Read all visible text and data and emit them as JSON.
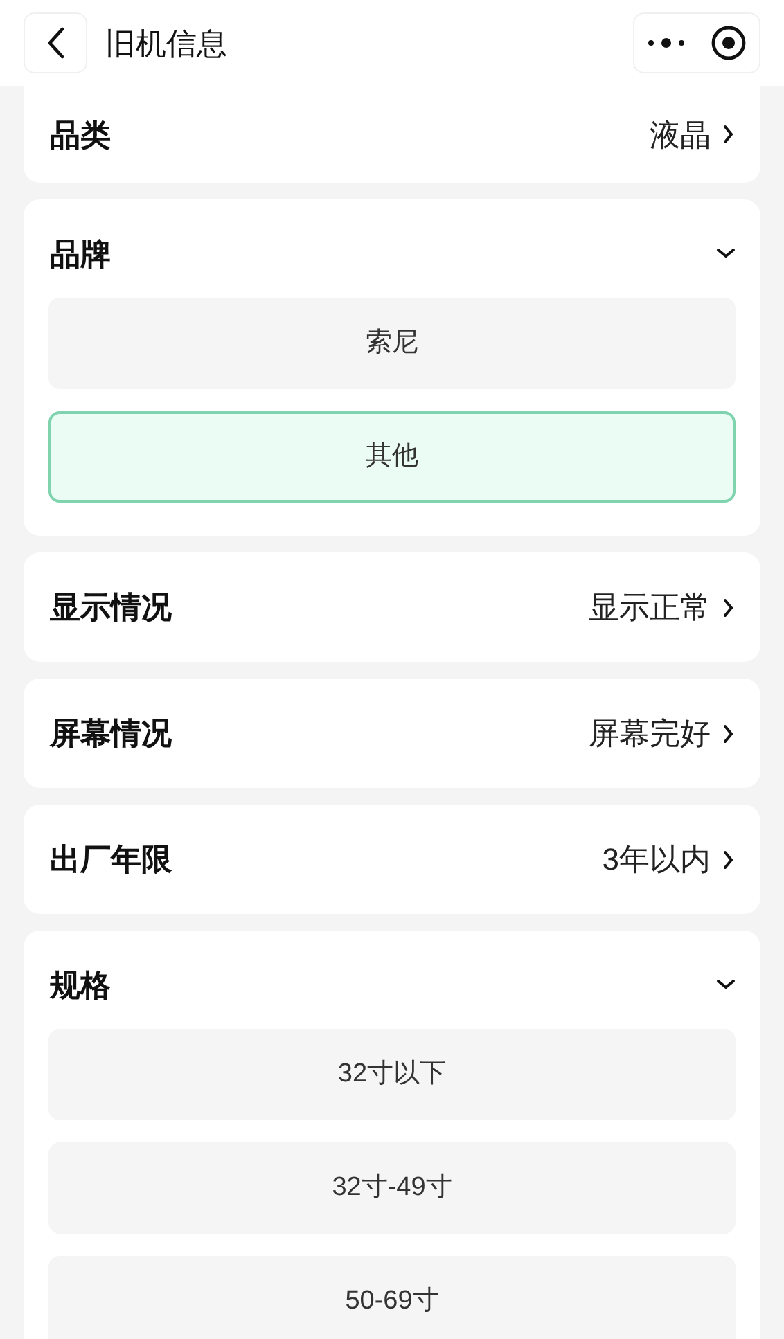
{
  "header": {
    "title": "旧机信息"
  },
  "sections": [
    {
      "kind": "select",
      "label": "品类",
      "value": "液晶"
    },
    {
      "kind": "options",
      "label": "品牌",
      "expanded": true,
      "options": [
        {
          "label": "索尼",
          "selected": false
        },
        {
          "label": "其他",
          "selected": true
        }
      ]
    },
    {
      "kind": "select",
      "label": "显示情况",
      "value": "显示正常"
    },
    {
      "kind": "select",
      "label": "屏幕情况",
      "value": "屏幕完好"
    },
    {
      "kind": "select",
      "label": "出厂年限",
      "value": "3年以内"
    },
    {
      "kind": "options",
      "label": "规格",
      "expanded": true,
      "options": [
        {
          "label": "32寸以下",
          "selected": false
        },
        {
          "label": "32寸-49寸",
          "selected": false
        },
        {
          "label": "50-69寸",
          "selected": false
        }
      ]
    }
  ]
}
